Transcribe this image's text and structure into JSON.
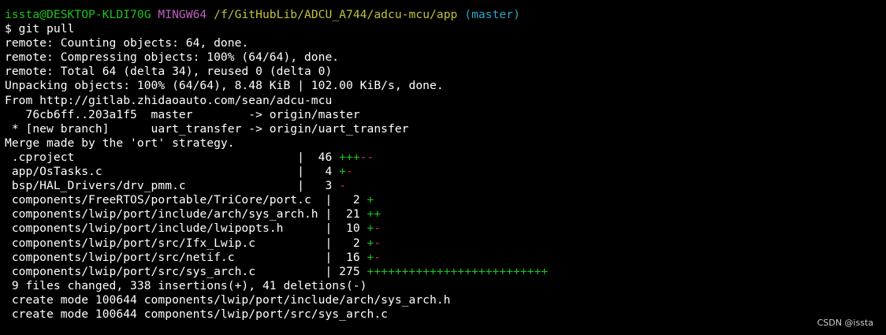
{
  "prompt": {
    "user_host": "issta@DESKTOP-KLDI70G",
    "shell": "MINGW64",
    "path": "/f/GitHubLib/ADCU_A744/adcu-mcu/app",
    "branch": "(master)"
  },
  "command": "$ git pull",
  "output": {
    "counting": "remote: Counting objects: 64, done.",
    "compressing": "remote: Compressing objects: 100% (64/64), done.",
    "total": "remote: Total 64 (delta 34), reused 0 (delta 0)",
    "unpacking": "Unpacking objects: 100% (64/64), 8.48 KiB | 102.00 KiB/s, done.",
    "from": "From http://gitlab.zhidaoauto.com/sean/adcu-mcu",
    "ref_update_1": "   76cb6ff..203a1f5  master        -> origin/master",
    "ref_update_2": " * [new branch]      uart_transfer -> origin/uart_transfer",
    "merge": "Merge made by the 'ort' strategy."
  },
  "diffstat": [
    {
      "prefix": " .cproject                                | ",
      "count": " 46 ",
      "plus": "+++",
      "minus": "--"
    },
    {
      "prefix": " app/OsTasks.c                            | ",
      "count": "  4 ",
      "plus": "+",
      "minus": "-"
    },
    {
      "prefix": " bsp/HAL_Drivers/drv_pmm.c                | ",
      "count": "  3 ",
      "plus": "",
      "minus": "-"
    },
    {
      "prefix": " components/FreeRTOS/portable/TriCore/port.c  | ",
      "count": "  2 ",
      "plus": "+",
      "minus": ""
    },
    {
      "prefix": " components/lwip/port/include/arch/sys_arch.h | ",
      "count": " 21 ",
      "plus": "++",
      "minus": ""
    },
    {
      "prefix": " components/lwip/port/include/lwipopts.h      | ",
      "count": " 10 ",
      "plus": "+",
      "minus": "-"
    },
    {
      "prefix": " components/lwip/port/src/Ifx_Lwip.c          | ",
      "count": "  2 ",
      "plus": "+",
      "minus": "-"
    },
    {
      "prefix": " components/lwip/port/src/netif.c             | ",
      "count": " 16 ",
      "plus": "+",
      "minus": "-"
    },
    {
      "prefix": " components/lwip/port/src/sys_arch.c          | ",
      "count": "275 ",
      "plus": "++++++++++++++++++++++++++",
      "minus": ""
    }
  ],
  "summary": " 9 files changed, 338 insertions(+), 41 deletions(-)",
  "create_modes": [
    " create mode 100644 components/lwip/port/include/arch/sys_arch.h",
    " create mode 100644 components/lwip/port/src/sys_arch.c"
  ],
  "watermark": "CSDN @issta",
  "colors": {
    "background": "#000000",
    "text": "#ffffff",
    "user_host": "#1cc21c",
    "shell": "#c15fc1",
    "path": "#c2c23a",
    "branch": "#27a9c7",
    "plus": "#1cc21c",
    "minus": "#d93b3b"
  }
}
